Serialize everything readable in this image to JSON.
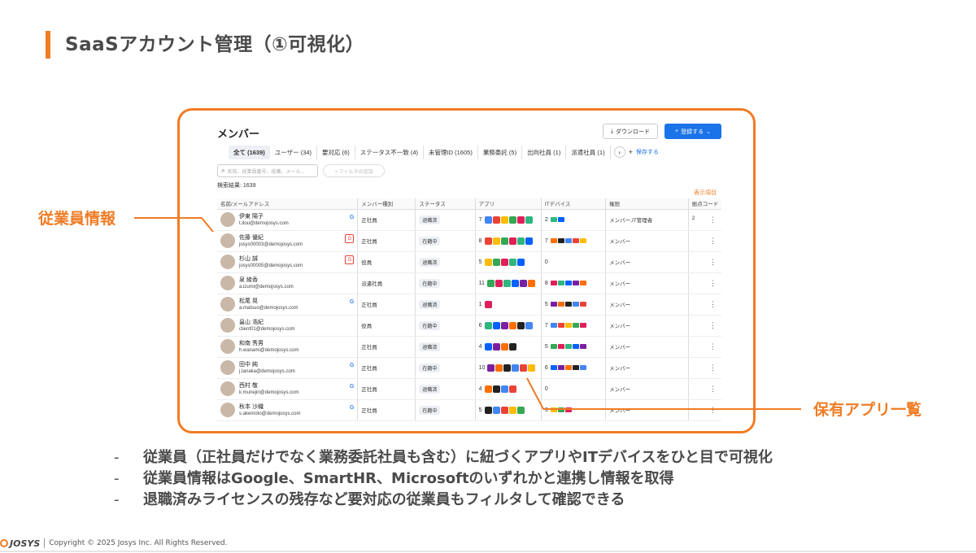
{
  "slide": {
    "title": "SaaSアカウント管理（①可視化）",
    "callout_left": "従業員情報",
    "callout_right": "保有アプリ一覧",
    "bullets": [
      "従業員（正社員だけでなく業務委託社員も含む）に紐づくアプリやITデバイスをひと目で可視化",
      "従業員情報はGoogle、SmartHR、Microsoftのいずれかと連携し情報を取得",
      "退職済みライセンスの残存など要対応の従業員もフィルタして確認できる"
    ],
    "bullet_marker": "-",
    "footer": {
      "logo_text": "JOSYS",
      "copyright": "Copyright © 2025 Josys Inc. All Rights Reserved."
    },
    "accent_color": "#F07C25"
  },
  "app": {
    "page_title": "メンバー",
    "download_label": "ダウンロード",
    "register_label": "登録する",
    "tabs": [
      "全て (1639)",
      "ユーザー (34)",
      "要対応 (6)",
      "ステータス不一致 (4)",
      "未管理ID (1605)",
      "業務委託 (5)",
      "出向社員 (1)",
      "派遣社員 (1)"
    ],
    "tab_save": "保存する",
    "search_placeholder": "名前、従業員番号、役職、メール...",
    "filter_add": "+ フィルタの追加",
    "result_label": "検索結果: 1639",
    "display_items": "表示項目",
    "columns": [
      "名前/メールアドレス",
      "メンバー種別",
      "ステータス",
      "アプリ",
      "ITデバイス",
      "権限",
      "拠点コード"
    ],
    "rows": [
      {
        "name": "伊東 陽子",
        "email": "t.itou@demojosys.com",
        "source": "G",
        "type": "正社員",
        "status": "退職済",
        "apps": "7",
        "devices": "2",
        "role": "メンバー,IT管理者",
        "site": "2"
      },
      {
        "name": "佐藤 優紀",
        "email": "josys00003@demojosys.com",
        "source": "box",
        "type": "正社員",
        "status": "在籍中",
        "apps": "8",
        "devices": "7",
        "role": "メンバー",
        "site": ""
      },
      {
        "name": "杉山 誠",
        "email": "josys00005@demojosys.com",
        "source": "box",
        "type": "役員",
        "status": "退職済",
        "apps": "5",
        "devices": "0",
        "role": "メンバー",
        "site": ""
      },
      {
        "name": "泉 綾香",
        "email": "a.izumi@demojosys.com",
        "source": "",
        "type": "派遣社員",
        "status": "在籍中",
        "apps": "11",
        "devices": "8",
        "role": "メンバー",
        "site": ""
      },
      {
        "name": "松尾 晃",
        "email": "a.matsuo@demojosys.com",
        "source": "G",
        "type": "正社員",
        "status": "退職済",
        "apps": "1",
        "devices": "5",
        "role": "メンバー",
        "site": ""
      },
      {
        "name": "畠山 浩紀",
        "email": "client01@demojosys.com",
        "source": "",
        "type": "役員",
        "status": "在籍中",
        "apps": "6",
        "devices": "7",
        "role": "メンバー",
        "site": ""
      },
      {
        "name": "和南 秀男",
        "email": "h.wanami@demojosys.com",
        "source": "",
        "type": "正社員",
        "status": "退職済",
        "apps": "4",
        "devices": "5",
        "role": "メンバー",
        "site": ""
      },
      {
        "name": "田中 純",
        "email": "j.tanaka@demojosys.com",
        "source": "G",
        "type": "正社員",
        "status": "在籍中",
        "apps": "10",
        "devices": "6",
        "role": "メンバー",
        "site": ""
      },
      {
        "name": "西村 敬",
        "email": "k.munejiri@demojosys.com",
        "source": "G",
        "type": "正社員",
        "status": "退職済",
        "apps": "4",
        "devices": "0",
        "role": "メンバー",
        "site": ""
      },
      {
        "name": "秋本 沙織",
        "email": "s.akemoto@demojosys.com",
        "source": "G",
        "type": "正社員",
        "status": "在籍中",
        "apps": "5",
        "devices": "3",
        "role": "メンバー",
        "site": ""
      }
    ]
  },
  "icon_palette": [
    "#4285F4",
    "#EA4335",
    "#FBBC05",
    "#34A853",
    "#E01E5A",
    "#2EB67D",
    "#0061FE",
    "#7B1FA2",
    "#FF6F00",
    "#222222"
  ]
}
